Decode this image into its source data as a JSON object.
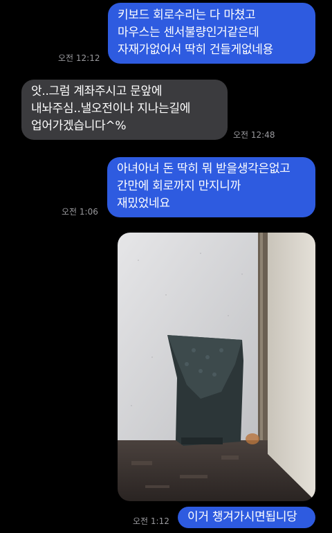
{
  "messages": [
    {
      "type": "sent",
      "lines": [
        "키보드 회로수리는 다 마쳤고",
        "마우스는 센서불량인거같은데",
        "자재가없어서 딱히 건들게없네용"
      ],
      "time": "오전 12:12"
    },
    {
      "type": "received",
      "lines": [
        "앗..그럼 계좌주시고 문앞에",
        "내놔주심..낼오전이나 지나는길에",
        "업어가겠습니다^%"
      ],
      "time": "오전 12:48"
    },
    {
      "type": "sent",
      "lines": [
        "아녀아녀 돈 딱히 뭐 받을생각은없고",
        "간만에 회로까지 만지니까",
        "재밌었네요"
      ],
      "time": "오전 1:06"
    },
    {
      "type": "sent",
      "lines": [
        "이거 챙겨가시면됩니당"
      ],
      "time": "오전 1:12"
    }
  ],
  "photo": {
    "alt_icon": "photo-of-wrapped-package",
    "colors": {
      "wall": "#cfd0d2",
      "door": "#d9d5cc",
      "floor": "#3a3230",
      "package": "#2c3638"
    }
  },
  "colors": {
    "sent": "#2e5be0",
    "received": "#3b3b3e",
    "background": "#000000",
    "time": "#9a9a9e"
  }
}
